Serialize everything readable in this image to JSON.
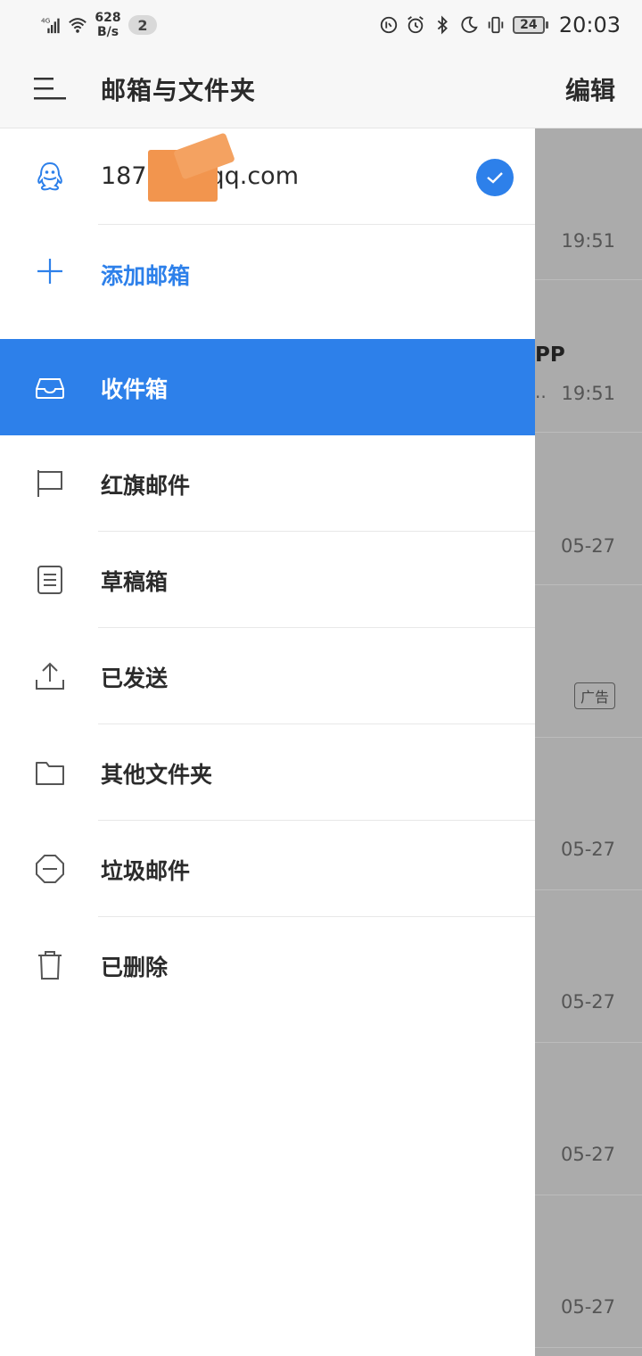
{
  "status_bar": {
    "network": "4G",
    "speed_value": "628",
    "speed_unit": "B/s",
    "notif_count": "2",
    "battery": "24",
    "time": "20:03",
    "icons": [
      "signal-icon",
      "wifi-icon",
      "dnd-icon",
      "alarm-icon",
      "bluetooth-icon",
      "moon-icon",
      "vibrate-icon",
      "battery-icon"
    ]
  },
  "header": {
    "title": "邮箱与文件夹",
    "edit_label": "编辑"
  },
  "account": {
    "email": "187        84@qq.com",
    "selected": true
  },
  "add_mailbox_label": "添加邮箱",
  "folders": [
    {
      "label": "收件箱",
      "icon": "inbox-icon",
      "active": true
    },
    {
      "label": "红旗邮件",
      "icon": "flag-icon",
      "active": false
    },
    {
      "label": "草稿箱",
      "icon": "draft-icon",
      "active": false
    },
    {
      "label": "已发送",
      "icon": "upload-icon",
      "active": false
    },
    {
      "label": "其他文件夹",
      "icon": "folder-icon",
      "active": false
    },
    {
      "label": "垃圾邮件",
      "icon": "spam-icon",
      "active": false
    },
    {
      "label": "已删除",
      "icon": "trash-icon",
      "active": false
    }
  ],
  "background_list": {
    "times": [
      "19:51",
      "19:51",
      "05-27",
      "",
      "05-27",
      "05-27",
      "05-27",
      "05-27"
    ],
    "frag_text": "PP",
    "dots": "..",
    "ad_label": "广告"
  },
  "colors": {
    "accent": "#2d80ea",
    "overlay": "#ababab"
  }
}
